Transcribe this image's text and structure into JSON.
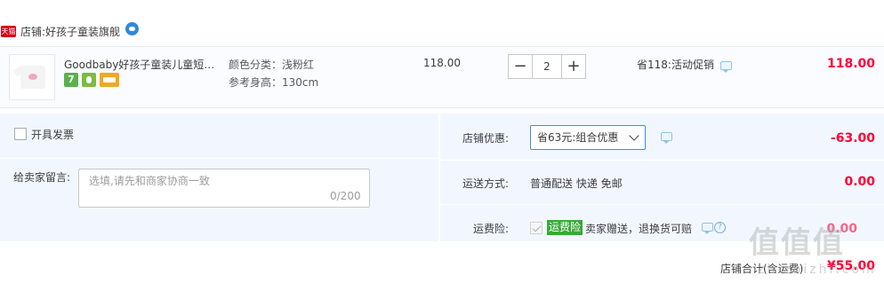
{
  "shop": {
    "badge": "天猫",
    "label": "店铺:",
    "name": "好孩子童装旗舰"
  },
  "item": {
    "title": "Goodbaby好孩子童装儿童短袖...",
    "services": [
      "7",
      "保障",
      "信用卡"
    ],
    "sku": [
      {
        "label": "颜色分类：浅粉红"
      },
      {
        "label": "参考身高：130cm"
      }
    ],
    "unit_price": "118.00",
    "quantity": "2",
    "minus": "−",
    "plus": "+",
    "promo": "省118:活动促销",
    "total": "118.00"
  },
  "invoice": {
    "label": "开具发票"
  },
  "memo": {
    "label": "给卖家留言:",
    "placeholder": "选填,请先和商家协商一致",
    "count": "0/200"
  },
  "discount": {
    "label": "店铺优惠:",
    "selected": "省63元:组合优惠",
    "value": "-63.00"
  },
  "shipping": {
    "label": "运送方式:",
    "value": "普通配送 快递 免邮",
    "price": "0.00"
  },
  "insurance": {
    "label": "运费险:",
    "tag": "运费险",
    "desc": "卖家赠送，退换货可赔",
    "help": "?",
    "value": "0.00"
  },
  "total": {
    "label": "店铺合计(含运费)",
    "value": "¥55.00"
  },
  "watermark": {
    "text": "值值值",
    "url": "zhizhizhi.com"
  }
}
